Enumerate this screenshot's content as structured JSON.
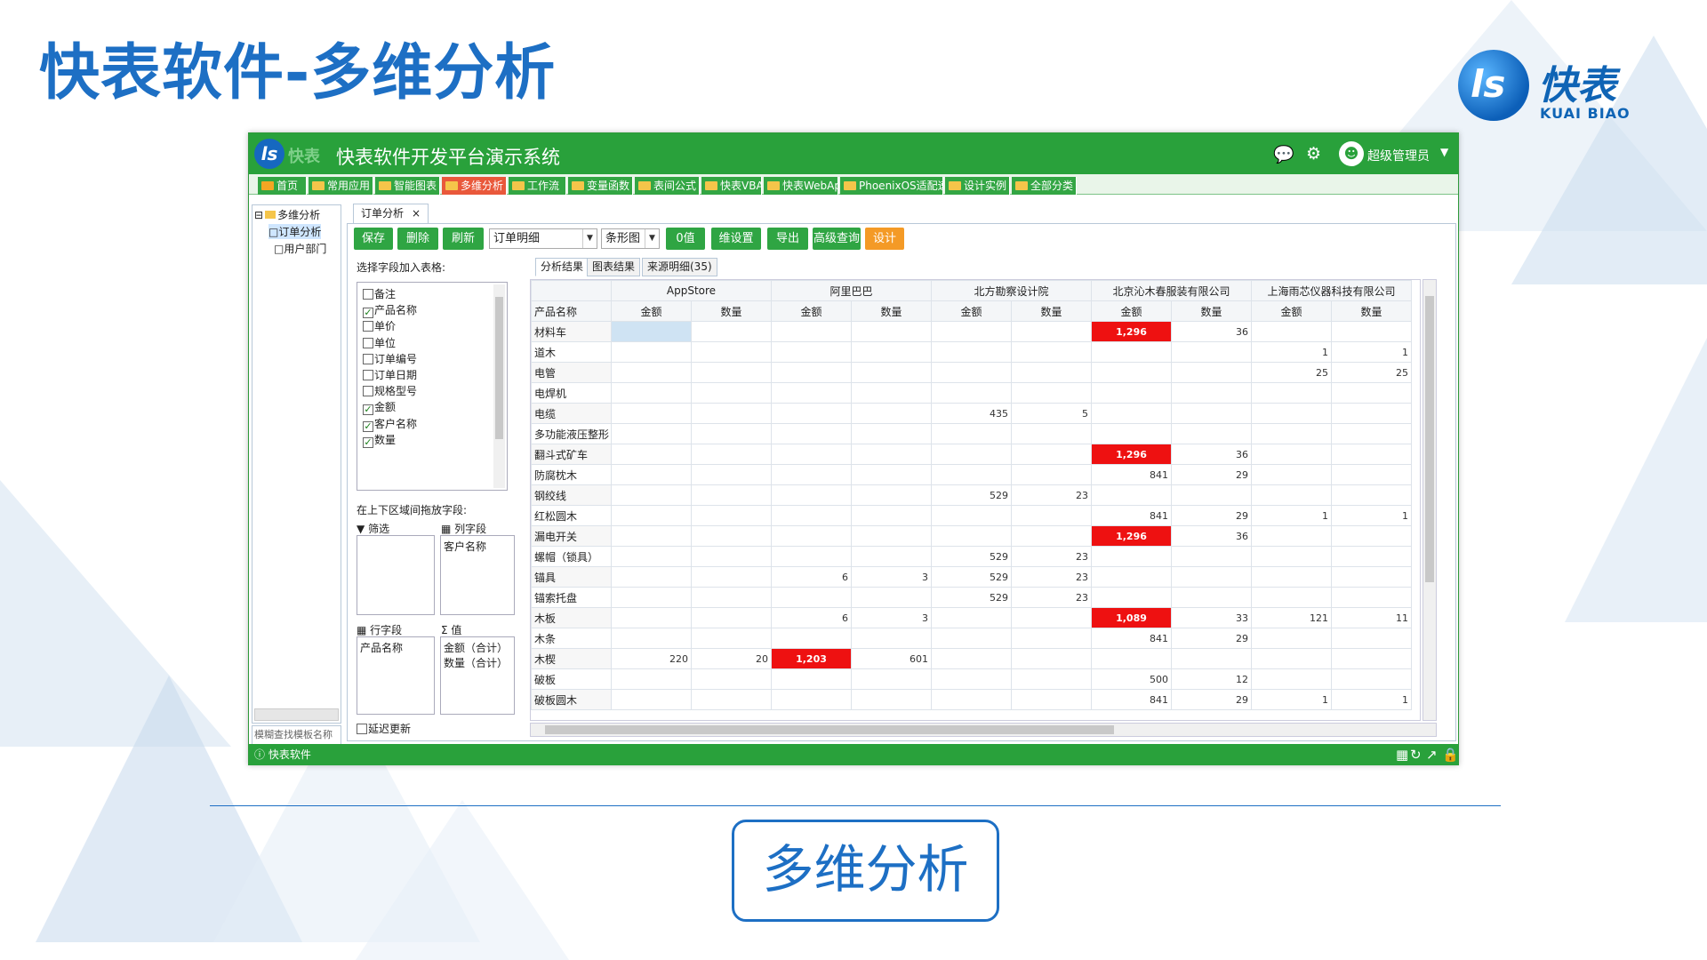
{
  "slide": {
    "title": "快表软件-多维分析",
    "brand_cn": "快表",
    "brand_en": "KUAI BIAO",
    "caption": "多维分析",
    "accent_color": "#1d6fc4"
  },
  "app": {
    "title": "快表软件开发平台演示系统",
    "logo_text": "快表",
    "user": "超级管理员",
    "header_icons": [
      "chat-icon",
      "gear-icon",
      "user-icon"
    ],
    "brand_color": "#29a13b",
    "menu": [
      "首页",
      "常用应用",
      "智能图表",
      "多维分析",
      "工作流",
      "变量函数",
      "表间公式",
      "快表VBA",
      "快表WebApp",
      "PhoenixOS适配速查",
      "设计实例",
      "全部分类"
    ],
    "active_menu": "多维分析",
    "status_text": "快表软件"
  },
  "tree": {
    "root": "多维分析",
    "children": [
      "订单分析",
      "用户部门"
    ],
    "selected": "订单分析",
    "search_placeholder": "模糊查找模板名称"
  },
  "doc_tab": {
    "label": "订单分析",
    "close": "×"
  },
  "toolbar": {
    "save": "保存",
    "delete": "删除",
    "refresh": "刷新",
    "source": "订单明细",
    "chart_type": "条形图",
    "zero": "0值",
    "dim_settings": "维设置",
    "export": "导出",
    "advanced_query": "高级查询",
    "design": "设计"
  },
  "field_panel": {
    "label": "选择字段加入表格:",
    "fields": [
      {
        "name": "备注",
        "checked": false
      },
      {
        "name": "产品名称",
        "checked": true
      },
      {
        "name": "单价",
        "checked": false
      },
      {
        "name": "单位",
        "checked": false
      },
      {
        "name": "订单编号",
        "checked": false
      },
      {
        "name": "订单日期",
        "checked": false
      },
      {
        "name": "规格型号",
        "checked": false
      },
      {
        "name": "金额",
        "checked": true
      },
      {
        "name": "客户名称",
        "checked": true
      },
      {
        "name": "数量",
        "checked": true
      }
    ],
    "drag_label": "在上下区域间拖放字段:",
    "filter_label": "筛选",
    "col_label": "列字段",
    "col_fields": [
      "客户名称"
    ],
    "row_label": "行字段",
    "row_fields": [
      "产品名称"
    ],
    "value_label": "值",
    "value_fields": [
      "金额（合计）",
      "数量（合计）"
    ],
    "defer_update": "延迟更新"
  },
  "result_tabs": [
    "分析结果",
    "图表结果",
    "来源明细(35)"
  ],
  "pivot": {
    "corner": "产品名称",
    "customers": [
      "AppStore",
      "阿里巴巴",
      "北方勘察设计院",
      "北京沁木春服装有限公司",
      "上海雨芯仪器科技有限公司"
    ],
    "measures": [
      "金额",
      "数量"
    ],
    "rows": [
      {
        "name": "材料车",
        "cells": [
          "",
          "",
          "",
          "",
          "",
          "",
          "1,296",
          "36",
          "",
          ""
        ]
      },
      {
        "name": "道木",
        "cells": [
          "",
          "",
          "",
          "",
          "",
          "",
          "",
          "",
          "1",
          "1"
        ]
      },
      {
        "name": "电管",
        "cells": [
          "",
          "",
          "",
          "",
          "",
          "",
          "",
          "",
          "25",
          "25"
        ]
      },
      {
        "name": "电焊机",
        "cells": [
          "",
          "",
          "",
          "",
          "",
          "",
          "",
          "",
          "",
          ""
        ]
      },
      {
        "name": "电缆",
        "cells": [
          "",
          "",
          "",
          "",
          "435",
          "5",
          "",
          "",
          "",
          ""
        ]
      },
      {
        "name": "多功能液压整形",
        "cells": [
          "",
          "",
          "",
          "",
          "",
          "",
          "",
          "",
          "",
          ""
        ]
      },
      {
        "name": "翻斗式矿车",
        "cells": [
          "",
          "",
          "",
          "",
          "",
          "",
          "1,296",
          "36",
          "",
          ""
        ]
      },
      {
        "name": "防腐枕木",
        "cells": [
          "",
          "",
          "",
          "",
          "",
          "",
          "841",
          "29",
          "",
          ""
        ]
      },
      {
        "name": "钢绞线",
        "cells": [
          "",
          "",
          "",
          "",
          "529",
          "23",
          "",
          "",
          "",
          ""
        ]
      },
      {
        "name": "红松圆木",
        "cells": [
          "",
          "",
          "",
          "",
          "",
          "",
          "841",
          "29",
          "1",
          "1"
        ]
      },
      {
        "name": "漏电开关",
        "cells": [
          "",
          "",
          "",
          "",
          "",
          "",
          "1,296",
          "36",
          "",
          ""
        ]
      },
      {
        "name": "螺帽（锁具）",
        "cells": [
          "",
          "",
          "",
          "",
          "529",
          "23",
          "",
          "",
          "",
          ""
        ]
      },
      {
        "name": "锚具",
        "cells": [
          "",
          "",
          "6",
          "3",
          "529",
          "23",
          "",
          "",
          "",
          ""
        ]
      },
      {
        "name": "锚索托盘",
        "cells": [
          "",
          "",
          "",
          "",
          "529",
          "23",
          "",
          "",
          "",
          ""
        ]
      },
      {
        "name": "木板",
        "cells": [
          "",
          "",
          "6",
          "3",
          "",
          "",
          "1,089",
          "33",
          "121",
          "11"
        ]
      },
      {
        "name": "木条",
        "cells": [
          "",
          "",
          "",
          "",
          "",
          "",
          "841",
          "29",
          "",
          ""
        ]
      },
      {
        "name": "木楔",
        "cells": [
          "220",
          "20",
          "1,203",
          "601",
          "",
          "",
          "",
          "",
          "",
          ""
        ]
      },
      {
        "name": "破板",
        "cells": [
          "",
          "",
          "",
          "",
          "",
          "",
          "500",
          "12",
          "",
          ""
        ]
      },
      {
        "name": "破板圆木",
        "cells": [
          "",
          "",
          "",
          "",
          "",
          "",
          "841",
          "29",
          "1",
          "1"
        ]
      }
    ],
    "highlight_color": "#ee1111"
  }
}
